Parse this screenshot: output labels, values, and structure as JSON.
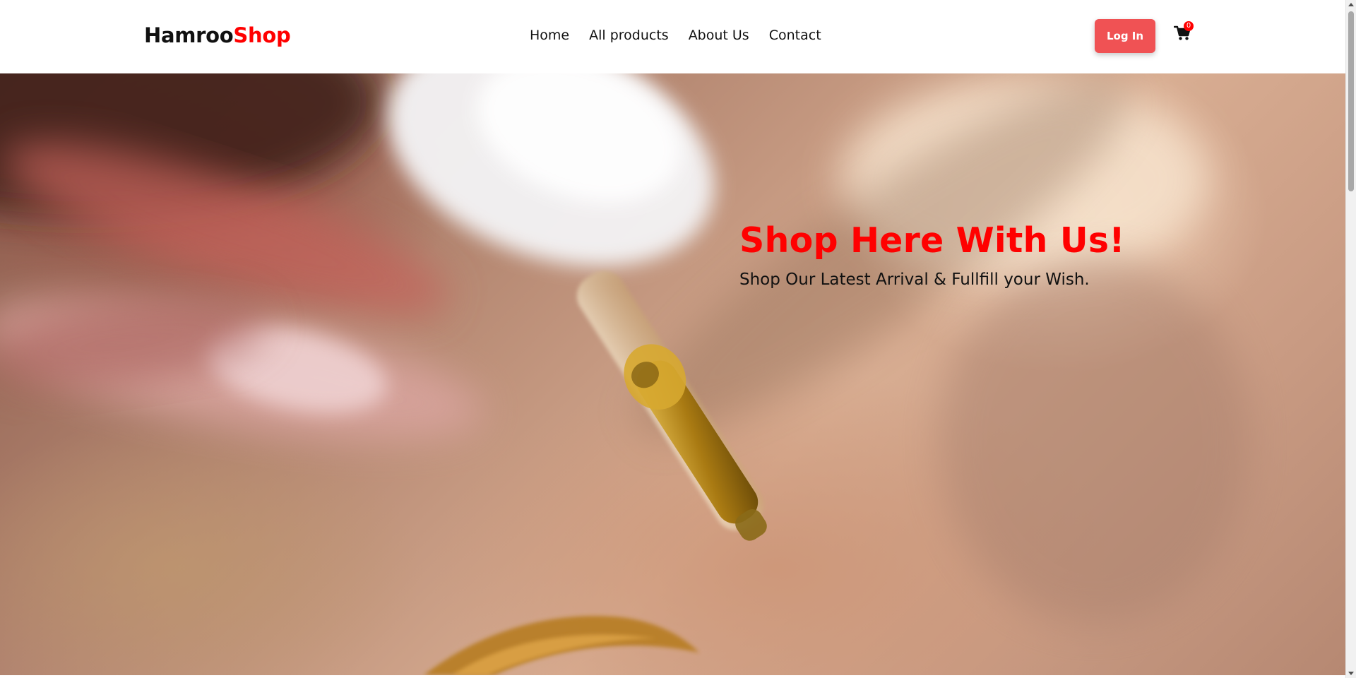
{
  "brand": {
    "part1": "Hamroo",
    "part2": "Shop",
    "accent_color": "#ff0000"
  },
  "nav": {
    "links": [
      {
        "label": "Home"
      },
      {
        "label": "All products"
      },
      {
        "label": "About Us"
      },
      {
        "label": "Contact"
      }
    ]
  },
  "header_actions": {
    "login_label": "Log In",
    "login_color": "#f05254",
    "cart_icon": "shopping-cart-icon",
    "cart_count": "0"
  },
  "hero": {
    "title": "Shop Here With Us!",
    "subtitle": "Shop Our Latest Arrival & Fullfill your Wish.",
    "title_color": "#ff0000",
    "background_image": "blurred close-up photo of a dropper with golden serum over skin"
  }
}
